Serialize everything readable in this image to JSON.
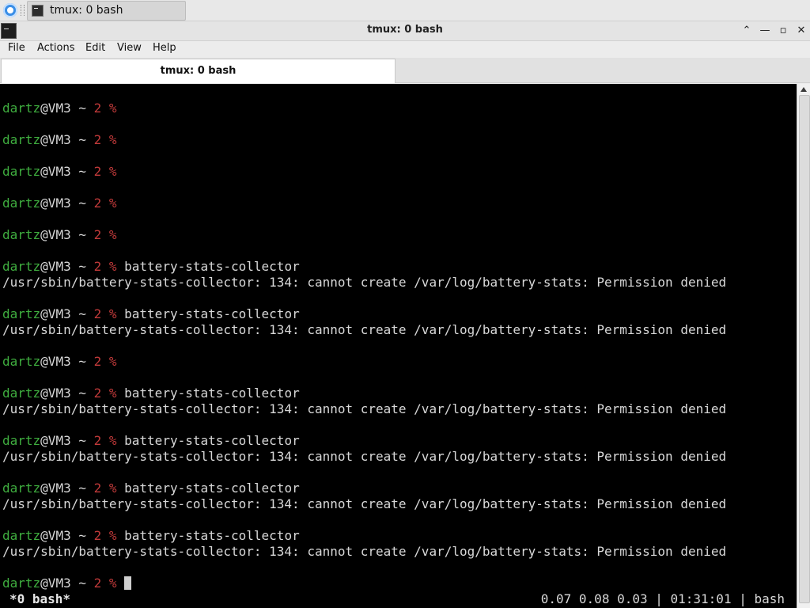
{
  "taskbar": {
    "task_label": "tmux: 0 bash"
  },
  "window": {
    "title": "tmux: 0 bash",
    "controls": {
      "keep_above": "⌃",
      "minimize": "—",
      "maximize": "▫",
      "close": "✕"
    }
  },
  "menu": {
    "items": [
      "File",
      "Actions",
      "Edit",
      "View",
      "Help"
    ]
  },
  "tabs": [
    {
      "label": "tmux: 0 bash"
    }
  ],
  "terminal": {
    "prompt": {
      "user": "dartz",
      "host_path": "@VM3 ~ ",
      "pct": "2 %"
    },
    "lines": [
      {
        "cmd": ""
      },
      {
        "cmd": ""
      },
      {
        "cmd": ""
      },
      {
        "cmd": ""
      },
      {
        "cmd": ""
      },
      {
        "cmd": " battery-stats-collector",
        "output": "/usr/sbin/battery-stats-collector: 134: cannot create /var/log/battery-stats: Permission denied"
      },
      {
        "cmd": " battery-stats-collector",
        "output": "/usr/sbin/battery-stats-collector: 134: cannot create /var/log/battery-stats: Permission denied"
      },
      {
        "cmd": ""
      },
      {
        "cmd": " battery-stats-collector",
        "output": "/usr/sbin/battery-stats-collector: 134: cannot create /var/log/battery-stats: Permission denied"
      },
      {
        "cmd": " battery-stats-collector",
        "output": "/usr/sbin/battery-stats-collector: 134: cannot create /var/log/battery-stats: Permission denied"
      },
      {
        "cmd": " battery-stats-collector",
        "output": "/usr/sbin/battery-stats-collector: 134: cannot create /var/log/battery-stats: Permission denied"
      },
      {
        "cmd": " battery-stats-collector",
        "output": "/usr/sbin/battery-stats-collector: 134: cannot create /var/log/battery-stats: Permission denied"
      },
      {
        "cmd": " "
      }
    ],
    "status_left": "*0 bash*",
    "status_right": "0.07 0.08 0.03 | 01:31:01 | bash"
  },
  "colors": {
    "user": "#3fae3f",
    "pct": "#c23a3a",
    "bg": "#000000"
  }
}
